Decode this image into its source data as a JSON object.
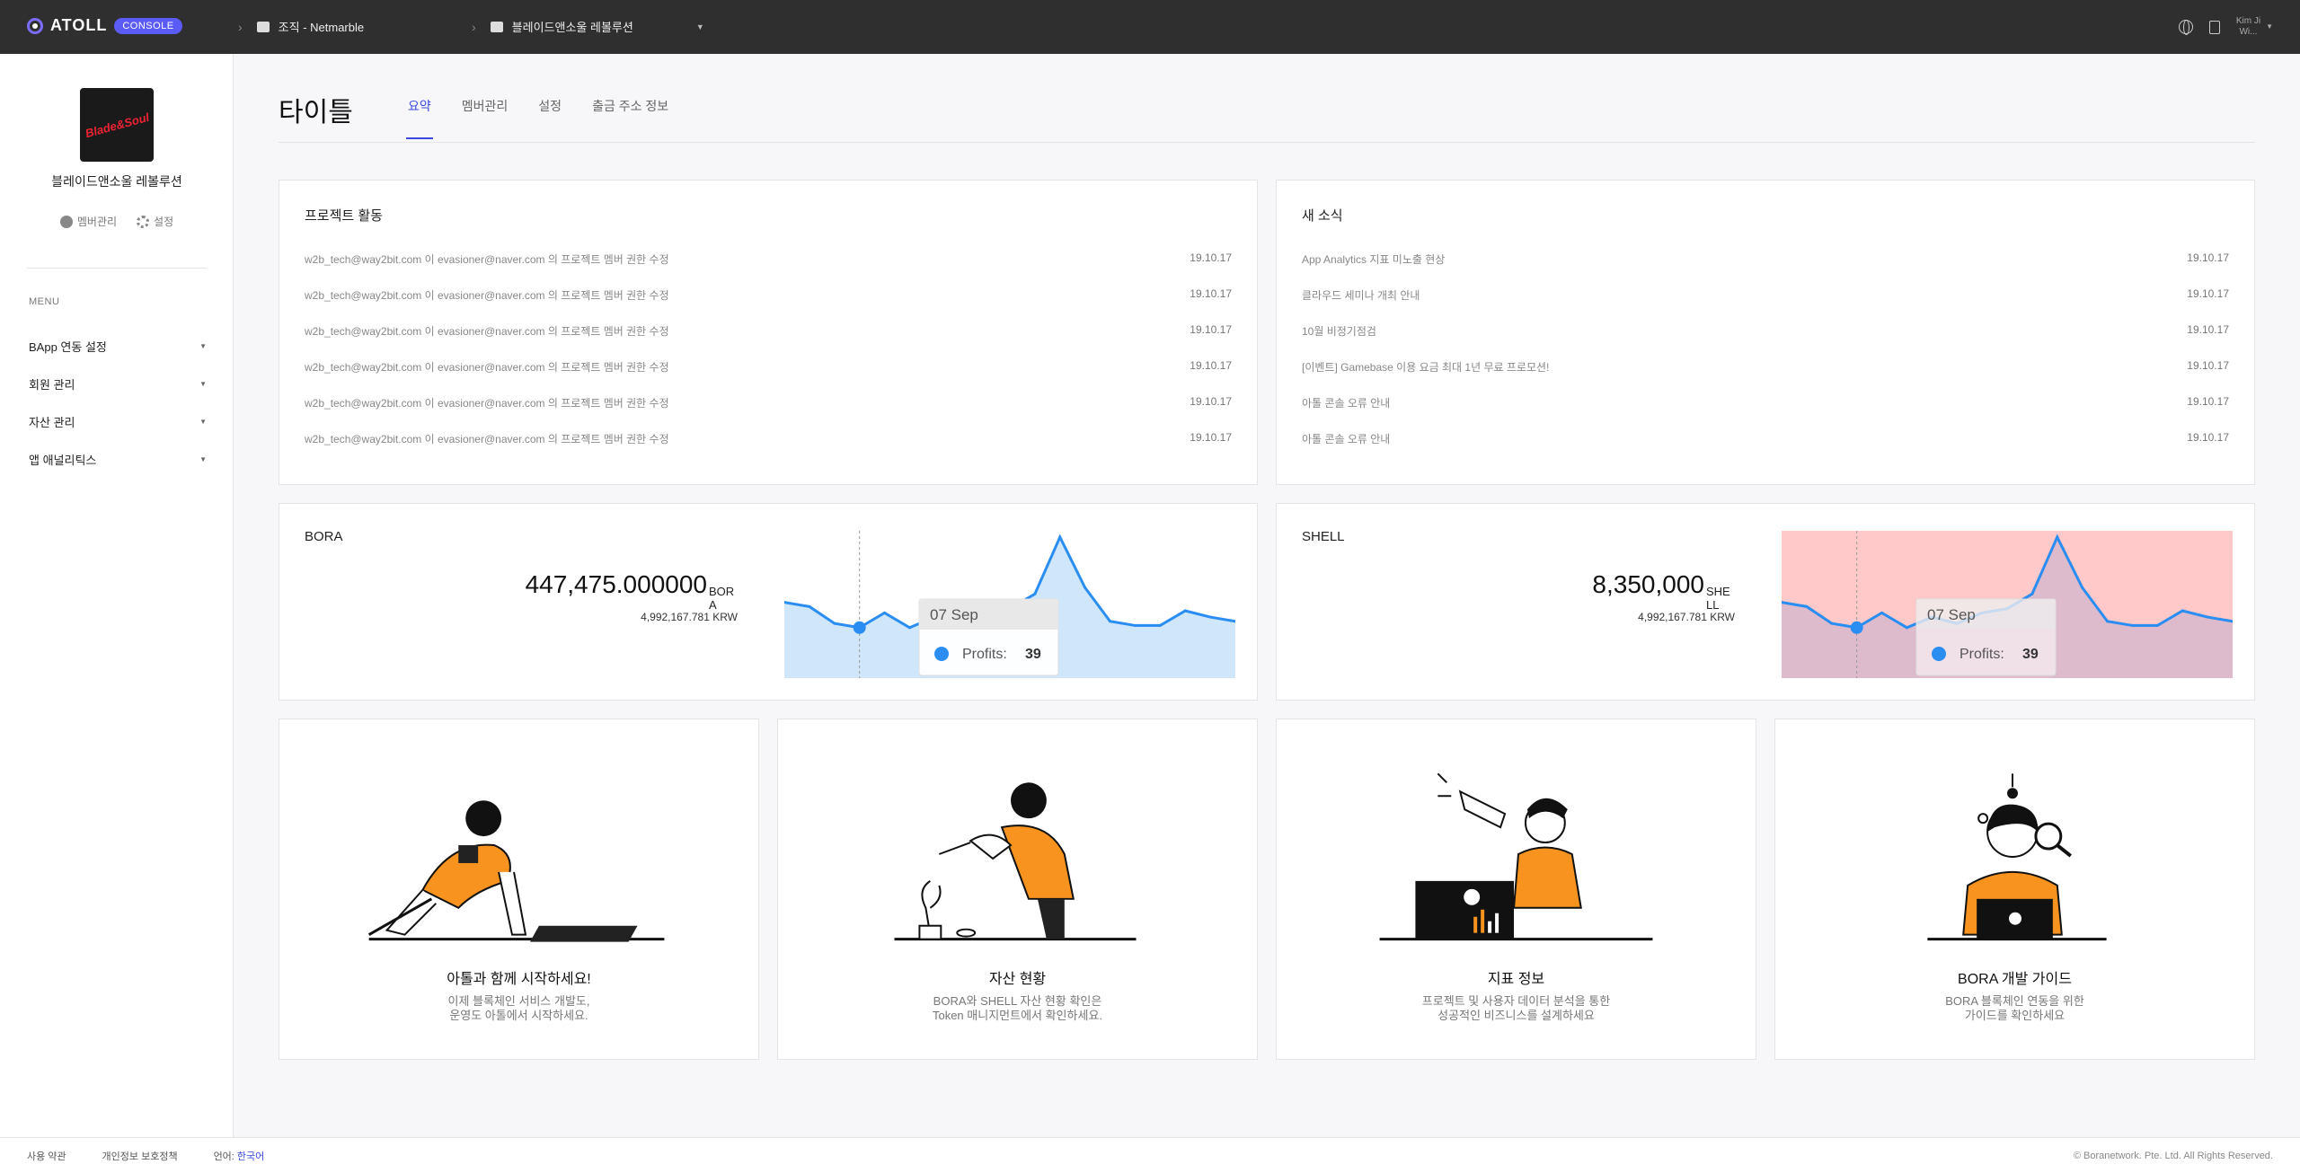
{
  "header": {
    "brand": "ATOLL",
    "badge": "CONSOLE",
    "org_crumb": "조직 - Netmarble",
    "project_crumb": "블레이드앤소울 레볼루션",
    "user_line1": "Kim Ji",
    "user_line2": "Wi..."
  },
  "sidebar": {
    "thumb_text": "Blade&Soul",
    "project_name": "블레이드앤소울 레볼루션",
    "member_link": "멤버관리",
    "settings_link": "설정",
    "menu_title": "MENU",
    "items": [
      {
        "label": "BApp 연동 설정"
      },
      {
        "label": "회원 관리"
      },
      {
        "label": "자산 관리"
      },
      {
        "label": "앱 애널리틱스"
      }
    ]
  },
  "main": {
    "title": "타이틀",
    "tabs": [
      {
        "label": "요약",
        "active": true
      },
      {
        "label": "멤버관리"
      },
      {
        "label": "설정"
      },
      {
        "label": "출금 주소 정보"
      }
    ]
  },
  "activity": {
    "title": "프로젝트 활동",
    "rows": [
      {
        "text": "w2b_tech@way2bit.com 이 evasioner@naver.com 의 프로젝트 멤버 권한 수정",
        "date": "19.10.17"
      },
      {
        "text": "w2b_tech@way2bit.com 이 evasioner@naver.com 의 프로젝트 멤버 권한 수정",
        "date": "19.10.17"
      },
      {
        "text": "w2b_tech@way2bit.com 이 evasioner@naver.com 의 프로젝트 멤버 권한 수정",
        "date": "19.10.17"
      },
      {
        "text": "w2b_tech@way2bit.com 이 evasioner@naver.com 의 프로젝트 멤버 권한 수정",
        "date": "19.10.17"
      },
      {
        "text": "w2b_tech@way2bit.com 이 evasioner@naver.com 의 프로젝트 멤버 권한 수정",
        "date": "19.10.17"
      },
      {
        "text": "w2b_tech@way2bit.com 이 evasioner@naver.com 의 프로젝트 멤버 권한 수정",
        "date": "19.10.17"
      }
    ]
  },
  "news": {
    "title": "새 소식",
    "rows": [
      {
        "text": "App Analytics 지표 미노출 현상",
        "date": "19.10.17"
      },
      {
        "text": "클라우드 세미나 개최 안내",
        "date": "19.10.17"
      },
      {
        "text": "10월 비정기점검",
        "date": "19.10.17"
      },
      {
        "text": "[이벤트] Gamebase 이용 요금 최대 1년 무료 프로모션!",
        "date": "19.10.17"
      },
      {
        "text": "아톨 콘솔 오류 안내",
        "date": "19.10.17"
      },
      {
        "text": "아톨 콘솔 오류 안내",
        "date": "19.10.17"
      }
    ]
  },
  "bora": {
    "title": "BORA",
    "amount": "447,475.000000",
    "unit": "BORA",
    "krw": "4,992,167.781 KRW",
    "tooltip_date": "07 Sep",
    "tooltip_label": "Profits:",
    "tooltip_value": "39"
  },
  "shell": {
    "title": "SHELL",
    "amount": "8,350,000",
    "unit": "SHELL",
    "krw": "4,992,167.781 KRW",
    "tooltip_date": "07 Sep",
    "tooltip_label": "Profits:",
    "tooltip_value": "39"
  },
  "chart_data": [
    {
      "type": "area",
      "values": [
        36,
        34,
        26,
        24,
        31,
        24,
        29,
        26,
        31,
        33,
        40,
        67,
        43,
        27,
        25,
        25,
        32,
        29,
        27
      ],
      "ylim": [
        0,
        70
      ],
      "color": "#2a8df2",
      "fill": "#cfe6fb"
    },
    {
      "type": "area",
      "values": [
        36,
        34,
        26,
        24,
        31,
        24,
        29,
        26,
        31,
        33,
        40,
        67,
        43,
        27,
        25,
        25,
        32,
        29,
        27
      ],
      "ylim": [
        0,
        70
      ],
      "color": "#2a8df2",
      "fill": "#ffc9c9"
    }
  ],
  "guides": [
    {
      "title": "아톨과 함께 시작하세요!",
      "line1": "이제 블록체인 서비스 개발도,",
      "line2": "운영도 아톨에서 시작하세요."
    },
    {
      "title": "자산 현황",
      "line1": "BORA와 SHELL 자산 현황 확인은",
      "line2": "Token 매니지먼트에서 확인하세요."
    },
    {
      "title": "지표 정보",
      "line1": "프로젝트 및 사용자 데이터 분석을 통한",
      "line2": "성공적인 비즈니스를 설계하세요"
    },
    {
      "title": "BORA 개발 가이드",
      "line1": "BORA 블록체인 연동을 위한",
      "line2": "가이드를 확인하세요"
    }
  ],
  "footer": {
    "terms": "사용 약관",
    "privacy": "개인정보 보호정책",
    "lang_label": "언어:",
    "lang_value": "한국어",
    "copyright": "© Boranetwork. Pte. Ltd. All Rights Reserved."
  },
  "colors": {
    "accent": "#3b49df",
    "topbar": "#2f2f2f",
    "illustration_orange": "#f7931e"
  }
}
